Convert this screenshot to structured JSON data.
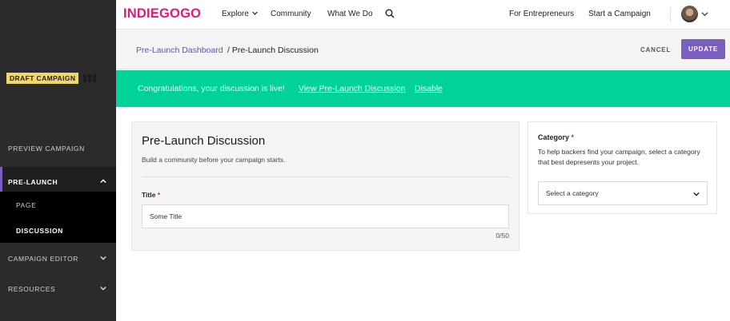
{
  "sidebar": {
    "badge": "DRAFT CAMPAIGN",
    "items": {
      "preview": "PREVIEW CAMPAIGN",
      "prelaunch": "PRE-LAUNCH",
      "page": "PAGE",
      "discussion": "DISCUSSION",
      "editor": "CAMPAIGN EDITOR",
      "resources": "RESOURCES"
    }
  },
  "nav": {
    "logo": "INDIEGOGO",
    "explore": "Explore",
    "community": "Community",
    "what_we_do": "What We Do",
    "for_entrepreneurs": "For Entrepreneurs",
    "start_campaign": "Start a Campaign"
  },
  "header": {
    "breadcrumb_link": "Pre-Launch Dashboard",
    "breadcrumb_current": "/ Pre-Launch Discussion",
    "cancel": "CANCEL",
    "update": "UPDATE"
  },
  "banner": {
    "message": "Congratulations, your discussion is live!",
    "view_link": "View Pre-Launch Discussion",
    "disable_link": "Disable"
  },
  "form": {
    "title": "Pre-Launch Discussion",
    "subtitle": "Build a community before your campaign starts.",
    "title_label": "Title",
    "required_mark": "*",
    "title_value": "Some Title",
    "counter": "0/50"
  },
  "category": {
    "label": "Category",
    "required_mark": "*",
    "help": "To help backers find your campaign, select a category that best depresents your project.",
    "select_value": "Select a category"
  },
  "colors": {
    "brand": "#eb1478",
    "accent": "#7b5fc0",
    "banner": "#00d29a",
    "badge": "#f2d66a"
  }
}
